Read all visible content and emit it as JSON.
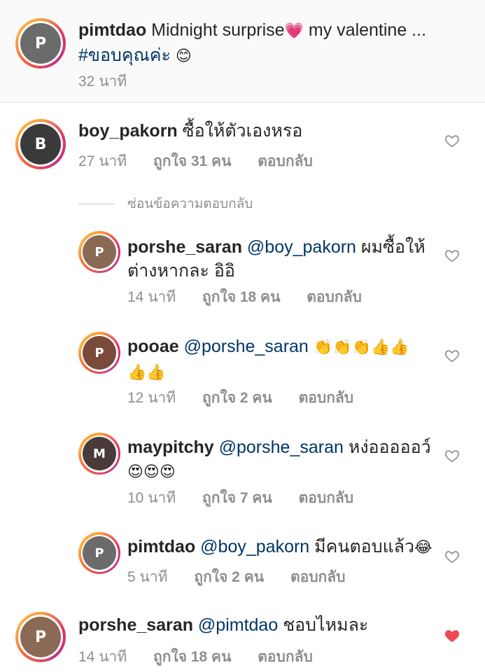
{
  "caption": {
    "username": "pimtdao",
    "text": "Midnight surprise",
    "emoji1": "💗",
    "text2": "my valentine ...",
    "hashtag": "#ขอบคุณค่ะ",
    "emoji2": "😊",
    "time": "32 นาที"
  },
  "comments": [
    {
      "username": "boy_pakorn",
      "text": "ซื้อให้ตัวเองหรอ",
      "time": "27 นาที",
      "likes": "ถูกใจ 31 คน",
      "reply": "ตอบกลับ"
    },
    {
      "username": "porshe_saran",
      "mention": "@pimtdao",
      "text": "ชอบไหมละ",
      "time": "14 นาที",
      "likes": "ถูกใจ 18 คน",
      "reply": "ตอบกลับ",
      "liked": true
    }
  ],
  "hide_replies": "ซ่อนข้อความตอบกลับ",
  "replies": [
    {
      "username": "porshe_saran",
      "mention": "@boy_pakorn",
      "text_line1": "ผมซื้อให้",
      "text_line2": "ต่างหากละ อิอิ",
      "time": "14 นาที",
      "likes": "ถูกใจ 18 คน",
      "reply": "ตอบกลับ"
    },
    {
      "username": "pooae",
      "mention": "@porshe_saran",
      "emoji_line1": "👏👏👏👍👍",
      "emoji_line2": "👍👍",
      "time": "12 นาที",
      "likes": "ถูกใจ 2 คน",
      "reply": "ตอบกลับ"
    },
    {
      "username": "maypitchy",
      "mention": "@porshe_saran",
      "text": "หง่อออออว์",
      "emoji_line2": "😍😍😍",
      "time": "10 นาที",
      "likes": "ถูกใจ 7 คน",
      "reply": "ตอบกลับ"
    },
    {
      "username": "pimtdao",
      "mention": "@boy_pakorn",
      "text": "มีคนตอบแล้ว",
      "emoji": "😂",
      "time": "5 นาที",
      "likes": "ถูกใจ 2 คน",
      "reply": "ตอบกลับ"
    }
  ],
  "colors": {
    "mention": "#003569",
    "meta": "#8e8e8e",
    "liked_heart": "#ed4956"
  }
}
